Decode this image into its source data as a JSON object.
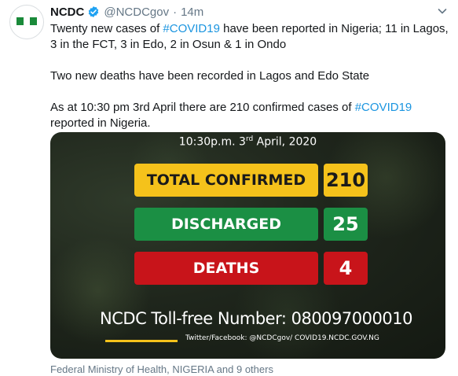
{
  "tweet": {
    "display_name": "NCDC",
    "handle": "@NCDCgov",
    "separator": "·",
    "time": "14m",
    "verified": true,
    "paragraph1": {
      "pre": "Twenty new cases of ",
      "hashtag": "#COVID19",
      "post": " have been reported in Nigeria; 11 in Lagos, 3 in the FCT, 3 in Edo, 2 in Osun & 1 in Ondo"
    },
    "paragraph2": "Two new deaths have been recorded in Lagos and Edo State",
    "paragraph3": {
      "pre": "As at 10:30 pm 3rd April there are 210 confirmed cases of ",
      "hashtag": "#COVID19",
      "post": " reported in Nigeria."
    },
    "footer": "Federal Ministry of Health, NIGERIA and 9 others"
  },
  "card": {
    "date_time": "10:30p.m.",
    "date_day": "3",
    "date_suffix": "rd",
    "date_rest": " April, 2020",
    "stats": [
      {
        "label": "TOTAL CONFIRMED",
        "value": "210",
        "color": "#f5c21b"
      },
      {
        "label": "DISCHARGED",
        "value": "25",
        "color": "#1b8f44"
      },
      {
        "label": "DEATHS",
        "value": "4",
        "color": "#c8141a"
      }
    ],
    "tollfree": "NCDC Toll-free Number: 080097000010",
    "social": "Twitter/Facebook: @NCDCgov/ COVID19.NCDC.GOV.NG"
  },
  "icons": {
    "verified": "verified-badge-icon",
    "menu": "chevron-down-icon"
  },
  "colors": {
    "hashtag": "#1b95e0",
    "muted": "#657786",
    "verified": "#1da1f2"
  }
}
